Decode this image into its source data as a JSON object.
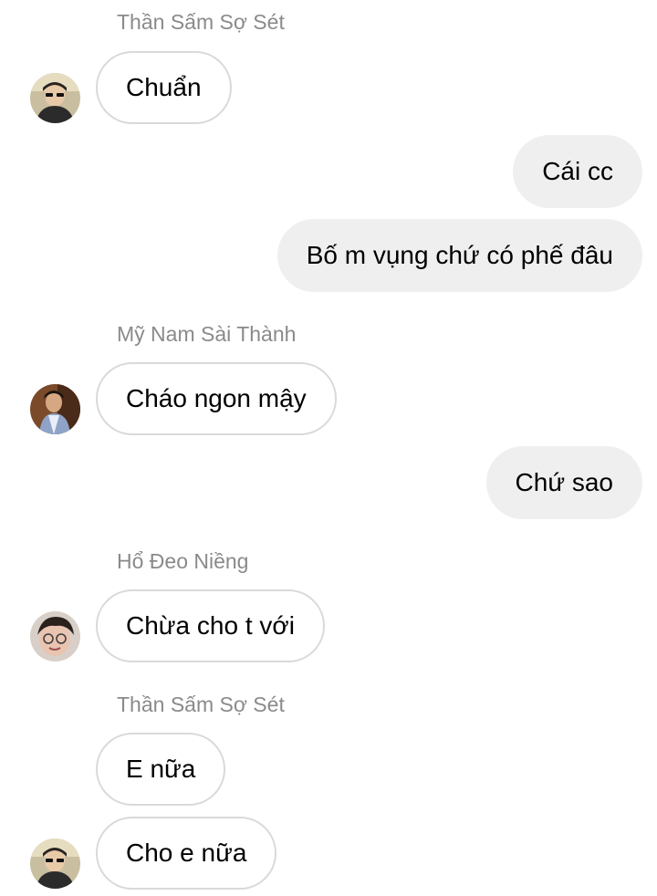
{
  "messages": [
    {
      "sender": "Thần Sấm Sợ Sét",
      "text": "Chuẩn"
    },
    {
      "text": "Cái cc"
    },
    {
      "text": "Bố m vụng chứ có phế đâu"
    },
    {
      "sender": "Mỹ Nam Sài Thành",
      "text": "Cháo ngon mậy"
    },
    {
      "text": "Chứ sao"
    },
    {
      "sender": "Hổ Đeo Niềng",
      "text": "Chừa cho t với"
    },
    {
      "sender": "Thần Sấm Sợ Sét",
      "text": "E nữa"
    },
    {
      "text": "Cho e nữa"
    }
  ],
  "colors": {
    "incoming_border": "#d9d9dc",
    "outgoing_bg": "#efefef",
    "sender_name": "#8a8a8d"
  },
  "avatars": [
    "avatar-than-sam",
    "avatar-my-nam",
    "avatar-ho-deo-nieng",
    "avatar-than-sam"
  ]
}
